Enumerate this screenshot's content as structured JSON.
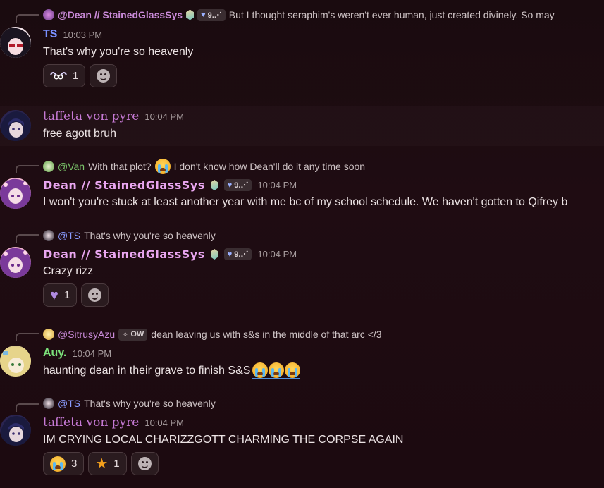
{
  "messages": [
    {
      "reply": {
        "mention": "@Dean // StainedGlassSys",
        "tag": "9.⋰",
        "text": "But I thought seraphim's weren't ever human, just created divinely. So may"
      },
      "author": "TS",
      "time": "10:03 PM",
      "text": "That's why you're so heavenly",
      "reactions": [
        {
          "emoji": "angel-eyes-emoji",
          "count": "1"
        }
      ]
    },
    {
      "author": "taffeta von pyre",
      "time": "10:04 PM",
      "text": "free agott bruh"
    },
    {
      "reply": {
        "mention": "@Van",
        "text_before": "With that plot?",
        "text_after": "I don't know how Dean'll do it any time soon"
      },
      "author": "Dean // StainedGlassSys",
      "tag": "9.⋰",
      "time": "10:04 PM",
      "text": "I won't you're stuck at least another year with me bc of my school schedule. We haven't gotten to Qifrey b"
    },
    {
      "reply": {
        "mention": "@TS",
        "text": "That's why you're so heavenly"
      },
      "author": "Dean // StainedGlassSys",
      "tag": "9.⋰",
      "time": "10:04 PM",
      "text": "Crazy rizz",
      "reactions": [
        {
          "emoji": "purple-heart-emoji",
          "count": "1"
        }
      ]
    },
    {
      "reply": {
        "mention": "@SitrusyAzu",
        "tag": "OW",
        "text": "dean leaving us with s&s in the middle of that arc </3"
      },
      "author": "Auy.",
      "time": "10:04 PM",
      "text": "haunting dean in their grave to finish S&S"
    },
    {
      "reply": {
        "mention": "@TS",
        "text": "That's why you're so heavenly"
      },
      "author": "taffeta von pyre",
      "time": "10:04 PM",
      "text": "IM CRYING LOCAL CHARIZZGOTT CHARMING THE CORPSE AGAIN",
      "reactions": [
        {
          "emoji": "crying-emoji",
          "count": "3"
        },
        {
          "emoji": "star-emoji",
          "count": "1"
        }
      ]
    }
  ],
  "colors": {
    "background": "#1c0a10",
    "dean_name": "#e9a6f0",
    "taffeta_name": "#c77ad6",
    "ts_name": "#7a90ff",
    "auy_name": "#7be07a",
    "timestamp": "#a59a9c"
  }
}
